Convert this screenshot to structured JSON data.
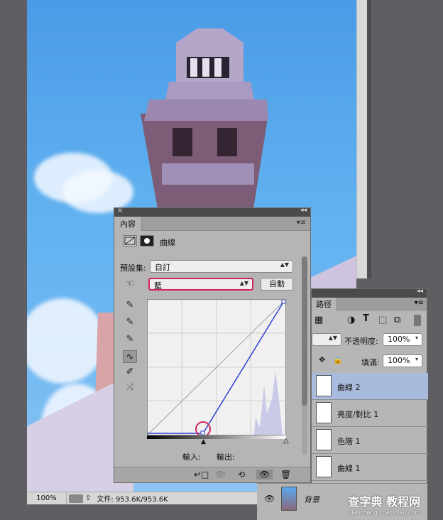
{
  "canvas": {
    "status": {
      "zoom": "100%",
      "doc_info": "文件: 953.6K/953.6K"
    }
  },
  "properties": {
    "tab": "內容",
    "adjustment_name": "曲線",
    "preset_label": "預設集:",
    "preset_value": "自訂",
    "channel_value": "藍",
    "auto_label": "自動",
    "input_label": "輸入:",
    "output_label": "輸出:",
    "accent_highlight": "#d0245f",
    "curve_color": "#2f3fd0"
  },
  "layers": {
    "tab": "路徑",
    "opacity_label": "不透明度:",
    "opacity_value": "100%",
    "fill_label": "填滿:",
    "fill_value": "100%",
    "items": [
      {
        "name": "曲線 2",
        "selected": true
      },
      {
        "name": "亮度/對比 1"
      },
      {
        "name": "色階 1"
      },
      {
        "name": "曲線 1"
      }
    ],
    "background_name": "背景"
  },
  "watermark": {
    "title": "查字典",
    "sub": "教程网",
    "url": "jiaocheng.chazidian.com"
  }
}
